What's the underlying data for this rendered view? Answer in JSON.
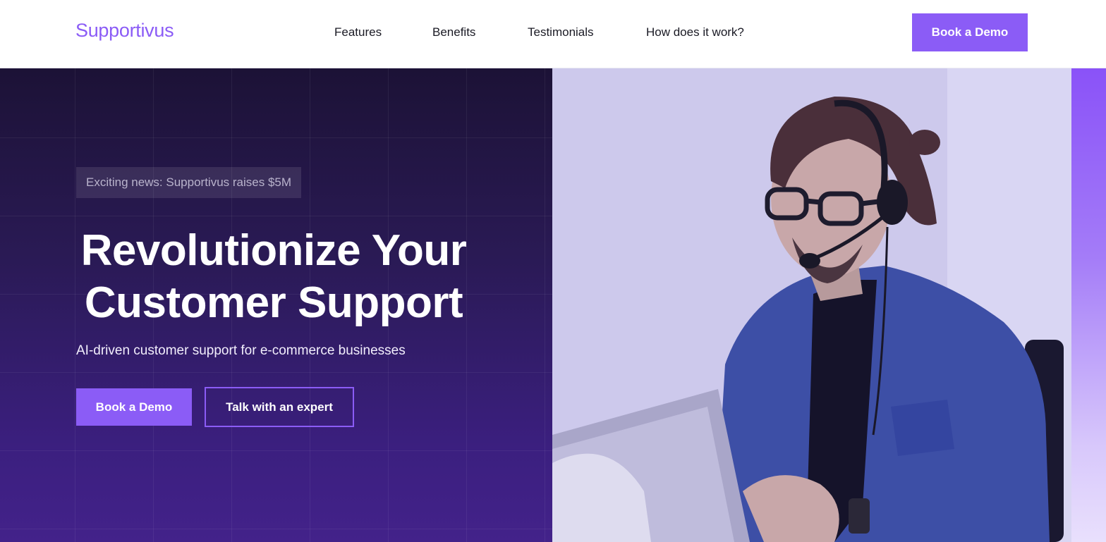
{
  "header": {
    "logo": "Supportivus",
    "nav": {
      "features": "Features",
      "benefits": "Benefits",
      "testimonials": "Testimonials",
      "how": "How does it work?"
    },
    "cta_label": "Book a Demo"
  },
  "hero": {
    "badge": "Exciting news: Supportivus raises $5M",
    "title_line1": "Revolutionize Your",
    "title_line2": "Customer Support",
    "subtitle": "AI-driven customer support for e-commerce businesses",
    "primary_button": "Book a Demo",
    "secondary_button": "Talk with an expert"
  },
  "colors": {
    "brand": "#8b5cf6",
    "hero_dark": "#1c1236",
    "hero_bottom": "#43228a"
  }
}
